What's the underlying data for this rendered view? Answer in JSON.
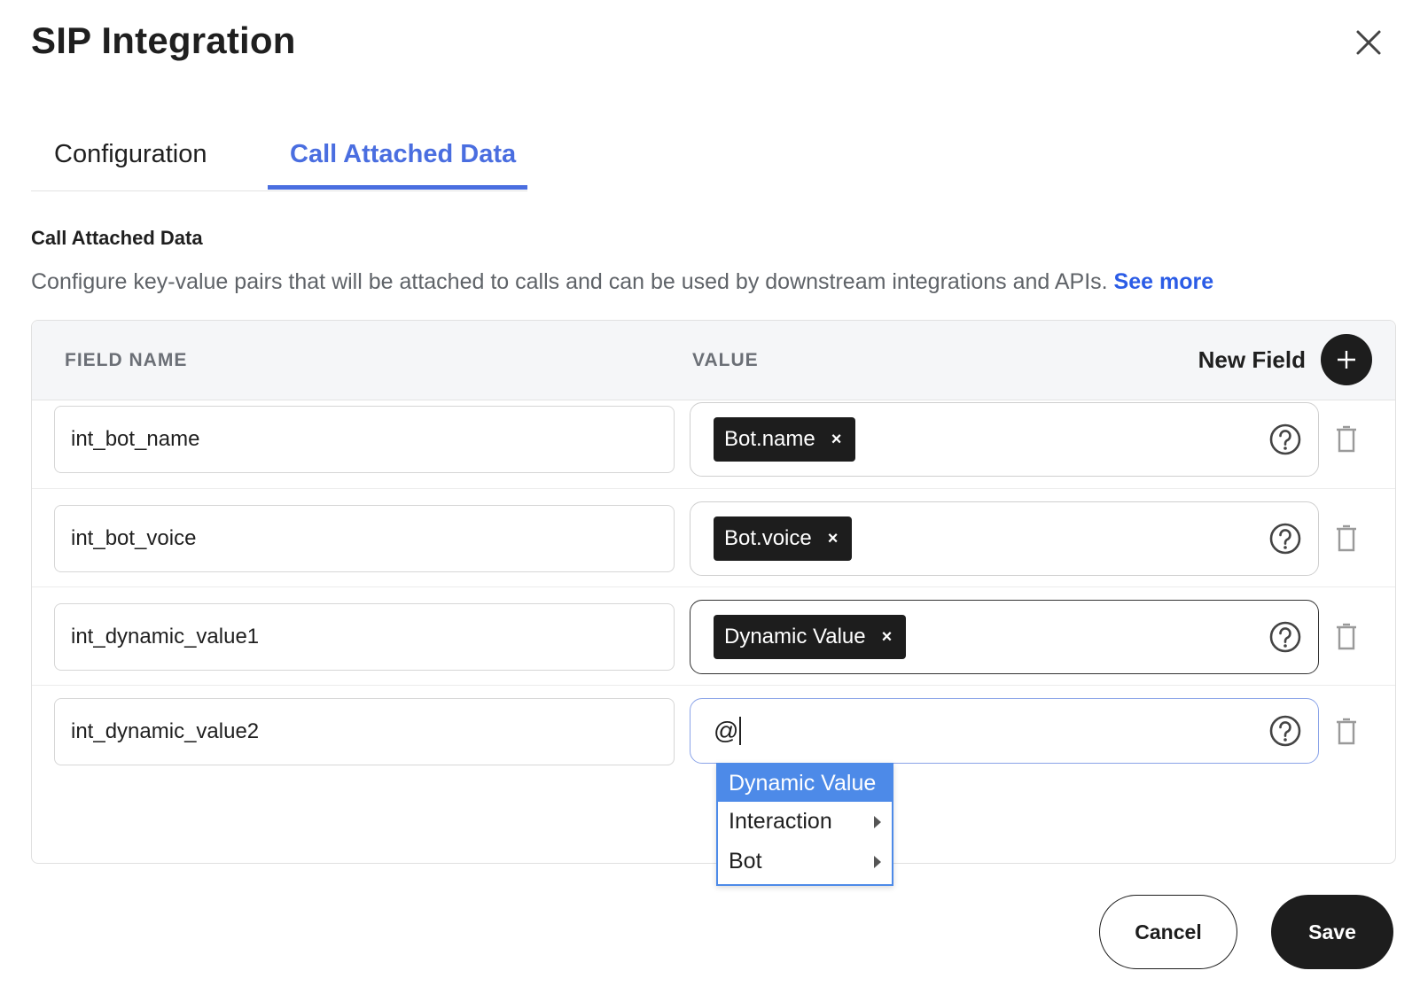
{
  "dialog": {
    "title": "SIP Integration",
    "close_icon": "close-icon"
  },
  "tabs": [
    {
      "label": "Configuration",
      "active": false
    },
    {
      "label": "Call Attached Data",
      "active": true
    }
  ],
  "section": {
    "title": "Call Attached Data",
    "description": "Configure key-value pairs that will be attached to calls and can be used by downstream integrations and APIs.",
    "link_text": "See more"
  },
  "table": {
    "headers": {
      "field_name": "FIELD NAME",
      "value": "VALUE"
    },
    "new_field_label": "New Field",
    "rows": [
      {
        "field_name": "int_bot_name",
        "value_chip": "Bot.name"
      },
      {
        "field_name": "int_bot_voice",
        "value_chip": "Bot.voice"
      },
      {
        "field_name": "int_dynamic_value1",
        "value_chip": "Dynamic Value"
      },
      {
        "field_name": "int_dynamic_value2",
        "value_text": "@"
      }
    ]
  },
  "dropdown": {
    "items": [
      {
        "label": "Dynamic Value",
        "selected": true,
        "submenu": false
      },
      {
        "label": "Interaction",
        "selected": false,
        "submenu": true
      },
      {
        "label": "Bot",
        "selected": false,
        "submenu": true
      }
    ]
  },
  "footer": {
    "cancel_label": "Cancel",
    "save_label": "Save"
  },
  "colors": {
    "accent": "#4a6ee0",
    "link": "#2b5ce6",
    "dark": "#1d1d1d",
    "dropdown_highlight": "#4d8ae8"
  }
}
